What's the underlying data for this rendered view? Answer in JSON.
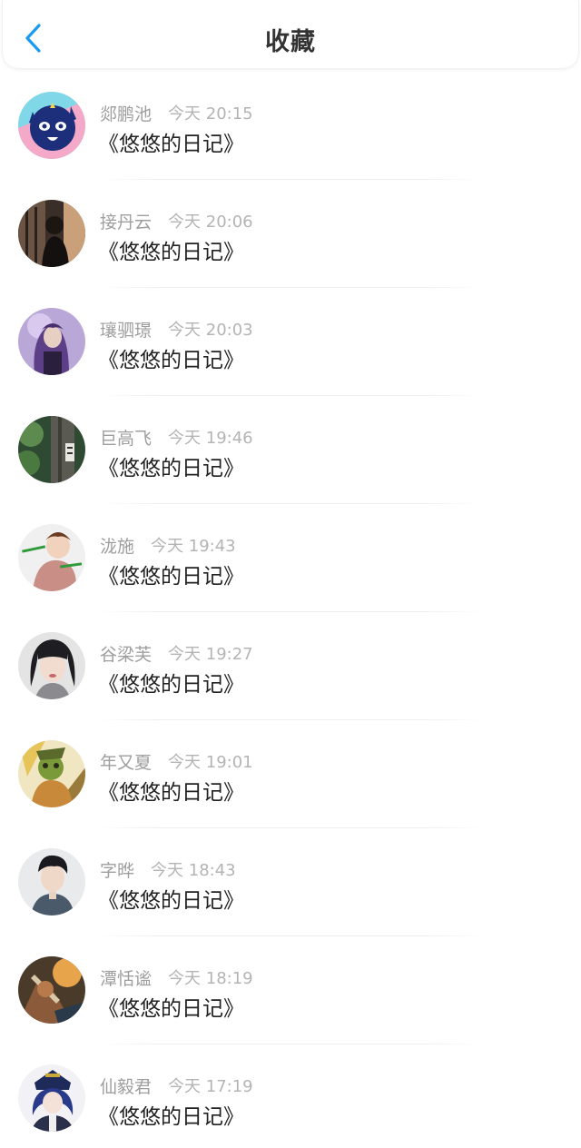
{
  "header": {
    "title": "收藏",
    "back_icon": "chevron-left-icon",
    "accent_color": "#1a9af0"
  },
  "items": [
    {
      "name": "郯鹏池",
      "time": "今天 20:15",
      "book": "《悠悠的日记》"
    },
    {
      "name": "接丹云",
      "time": "今天 20:06",
      "book": "《悠悠的日记》"
    },
    {
      "name": "瓖驷璟",
      "time": "今天 20:03",
      "book": "《悠悠的日记》"
    },
    {
      "name": "巨高飞",
      "time": "今天 19:46",
      "book": "《悠悠的日记》"
    },
    {
      "name": "泷施",
      "time": "今天 19:43",
      "book": "《悠悠的日记》"
    },
    {
      "name": "谷梁芙",
      "time": "今天 19:27",
      "book": "《悠悠的日记》"
    },
    {
      "name": "年又夏",
      "time": "今天 19:01",
      "book": "《悠悠的日记》"
    },
    {
      "name": "字晔",
      "time": "今天 18:43",
      "book": "《悠悠的日记》"
    },
    {
      "name": "潭恬谧",
      "time": "今天 18:19",
      "book": "《悠悠的日记》"
    },
    {
      "name": "仙毅君",
      "time": "今天 17:19",
      "book": "《悠悠的日记》"
    }
  ]
}
